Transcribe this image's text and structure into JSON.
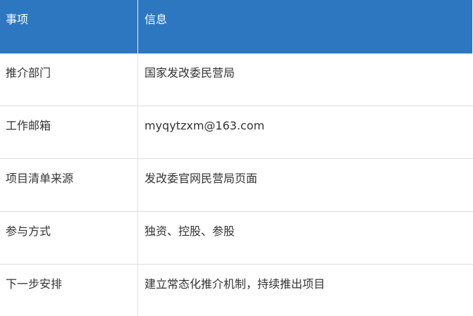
{
  "table": {
    "headers": [
      "事项",
      "信息"
    ],
    "rows": [
      [
        "推介部门",
        "国家发改委民营局"
      ],
      [
        "工作邮箱",
        "myqytzxm@163.com"
      ],
      [
        "项目清单来源",
        "发改委官网民营局页面"
      ],
      [
        "参与方式",
        "独资、控股、参股"
      ],
      [
        "下一步安排",
        "建立常态化推介机制，持续推出项目"
      ]
    ]
  },
  "colors": {
    "header_bg": "#2d77c1",
    "header_text": "#ffffff",
    "body_text": "#333333",
    "border": "#dddddd"
  }
}
